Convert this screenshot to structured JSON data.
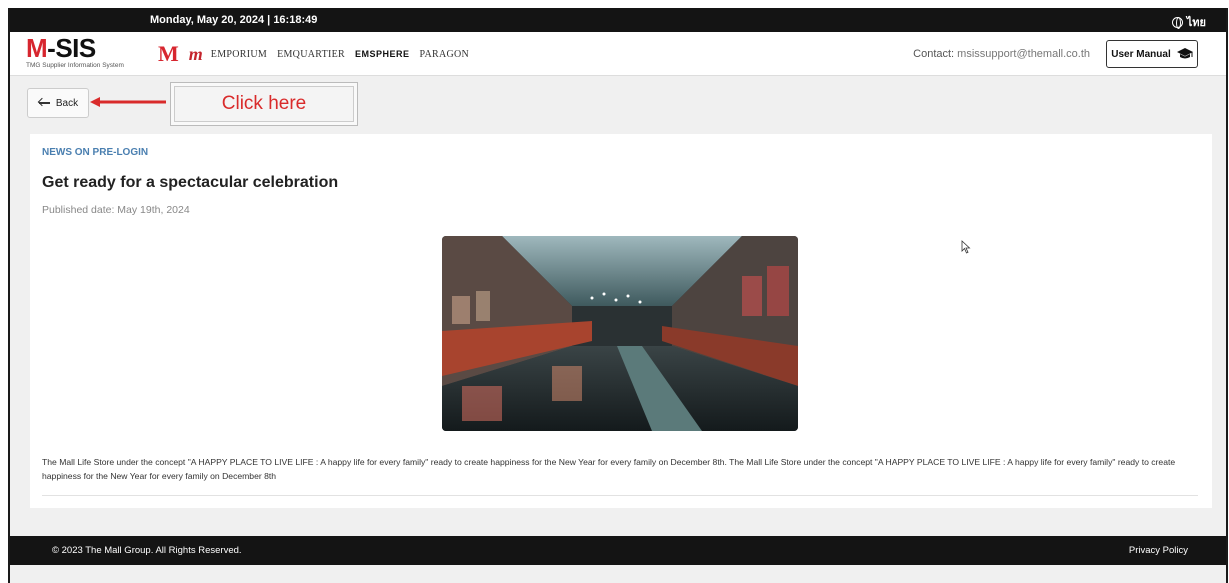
{
  "topbar": {
    "datetime": "Monday, May 20, 2024 | 16:18:49",
    "language": "ไทย",
    "language_icon": "globe-icon"
  },
  "header": {
    "logo_text": "M-SIS",
    "logo_prefix": "M",
    "logo_suffix": "-SIS",
    "logo_subtitle": "TMG Supplier Information System",
    "brands": [
      "M",
      "m",
      "EMPORIUM",
      "EMQUARTIER",
      "EMSPHERE",
      "PARAGON"
    ],
    "contact_label": "Contact:",
    "contact_email": "msissupport@themall.co.th",
    "manual_label": "User Manual",
    "manual_icon": "graduation-cap-icon"
  },
  "nav": {
    "back_label": "Back"
  },
  "annotation": {
    "text": "Click here",
    "color": "#d92b2b"
  },
  "article": {
    "breadcrumb": "NEWS ON PRE-LOGIN",
    "title": "Get ready for a spectacular celebration",
    "published": "Published date: May 19th, 2024",
    "body": "The Mall Life Store under the concept \"A HAPPY PLACE TO LIVE LIFE : A happy life for every family\" ready to create happiness for the New Year for every family on December 8th. The Mall Life Store under the concept \"A HAPPY PLACE TO LIVE LIFE : A happy life for every family\" ready to create happiness for the New Year for every family on December 8th"
  },
  "footer": {
    "copyright": "© 2023 The Mall Group. All Rights Reserved.",
    "privacy": "Privacy Policy"
  },
  "colors": {
    "brand_red": "#d7262f",
    "dark_bar": "#141414",
    "link_blue": "#4a7fb0"
  }
}
